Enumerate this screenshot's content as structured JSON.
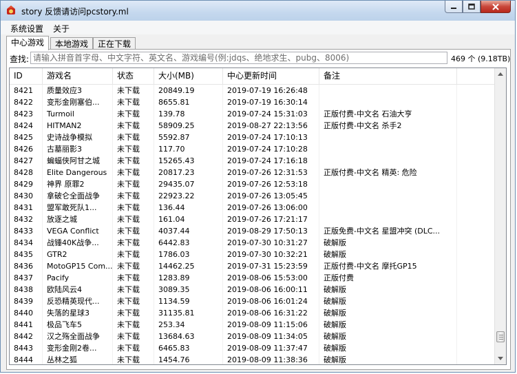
{
  "window": {
    "title": "story 反馈请访问pcstory.ml"
  },
  "menu": {
    "items": [
      "系统设置",
      "关于"
    ]
  },
  "tabs": [
    {
      "label": "中心游戏",
      "active": true
    },
    {
      "label": "本地游戏",
      "active": false
    },
    {
      "label": "正在下载",
      "active": false
    }
  ],
  "search": {
    "label": "查找:",
    "placeholder": "请输入拼音首字母、中文字符、英文名、游戏编号(例:jdqs、绝地求生、pubg、8006)",
    "count_text": "469 个 (9.18TB)"
  },
  "table": {
    "columns": [
      "ID",
      "游戏名",
      "状态",
      "大小(MB)",
      "中心更新时间",
      "备注"
    ],
    "rows": [
      [
        "8421",
        "质量效应3",
        "未下载",
        "20849.19",
        "2019-07-19 16:26:48",
        ""
      ],
      [
        "8422",
        "变形金刚塞伯...",
        "未下载",
        "8655.81",
        "2019-07-19 16:30:14",
        ""
      ],
      [
        "8423",
        "Turmoil",
        "未下载",
        "139.78",
        "2019-07-24 15:31:03",
        "正版付费-中文名 石油大亨"
      ],
      [
        "8424",
        "HITMAN2",
        "未下载",
        "58909.25",
        "2019-08-27 22:13:56",
        "正版付费-中文名 杀手2"
      ],
      [
        "8425",
        "史诗战争模拟",
        "未下载",
        "5592.87",
        "2019-07-24 17:10:13",
        ""
      ],
      [
        "8426",
        "古墓丽影3",
        "未下载",
        "117.70",
        "2019-07-24 17:10:28",
        ""
      ],
      [
        "8427",
        "蝙蝠侠阿甘之城",
        "未下载",
        "15265.43",
        "2019-07-24 17:16:18",
        ""
      ],
      [
        "8428",
        "Elite Dangerous",
        "未下载",
        "20817.23",
        "2019-07-26 12:31:53",
        "正版付费-中文名 精英: 危险"
      ],
      [
        "8429",
        "神界 原罪2",
        "未下载",
        "29435.07",
        "2019-07-26 12:53:18",
        ""
      ],
      [
        "8430",
        "拿破仑全面战争",
        "未下载",
        "22923.22",
        "2019-07-26 13:05:45",
        ""
      ],
      [
        "8431",
        "盟军敢死队1...",
        "未下载",
        "136.44",
        "2019-07-26 13:06:00",
        ""
      ],
      [
        "8432",
        "放逐之城",
        "未下载",
        "161.04",
        "2019-07-26 17:21:17",
        ""
      ],
      [
        "8433",
        "VEGA Conflict",
        "未下载",
        "4037.44",
        "2019-08-29 17:50:13",
        "正版免费-中文名 星盟冲突 (DLC..."
      ],
      [
        "8434",
        "战锤40K战争...",
        "未下载",
        "6442.83",
        "2019-07-30 10:31:27",
        "破解版"
      ],
      [
        "8435",
        "GTR2",
        "未下载",
        "1786.03",
        "2019-07-30 10:32:21",
        "破解版"
      ],
      [
        "8436",
        "MotoGP15 Com...",
        "未下载",
        "14462.25",
        "2019-07-31 15:23:59",
        "正版付费-中文名 摩托GP15"
      ],
      [
        "8437",
        "Pacify",
        "未下载",
        "1283.89",
        "2019-08-06 15:53:00",
        "正版付费"
      ],
      [
        "8438",
        "欧陆风云4",
        "未下载",
        "3089.35",
        "2019-08-06 16:00:11",
        "破解版"
      ],
      [
        "8439",
        "反恐精英现代...",
        "未下载",
        "1134.59",
        "2019-08-06 16:01:24",
        "破解版"
      ],
      [
        "8440",
        "失落的星球3",
        "未下载",
        "31135.81",
        "2019-08-06 16:31:22",
        "破解版"
      ],
      [
        "8441",
        "极品飞车5",
        "未下载",
        "253.34",
        "2019-08-09 11:15:06",
        "破解版"
      ],
      [
        "8442",
        "汉之殇全面战争",
        "未下载",
        "13684.63",
        "2019-08-09 11:34:05",
        "破解版"
      ],
      [
        "8443",
        "变形金刚2卷...",
        "未下载",
        "6465.83",
        "2019-08-09 11:37:47",
        "破解版"
      ],
      [
        "8444",
        "丛林之狐",
        "未下载",
        "1454.76",
        "2019-08-09 11:38:36",
        "破解版"
      ]
    ]
  },
  "scrollbar": {
    "position_fraction": 0.96
  }
}
